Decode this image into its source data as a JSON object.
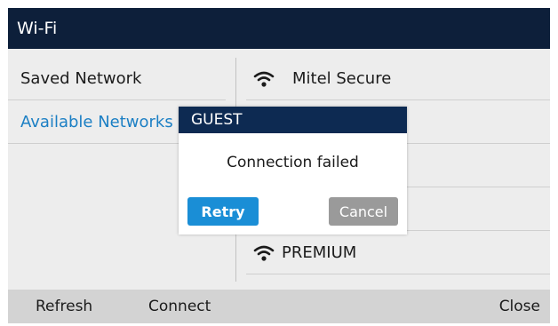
{
  "window": {
    "title": "Wi-Fi"
  },
  "left_menu": {
    "items": [
      {
        "label": "Saved Network",
        "active": false
      },
      {
        "label": "Available Networks",
        "active": true
      }
    ]
  },
  "networks": [
    {
      "ssid": "Mitel Secure",
      "icon": "wifi-icon"
    },
    {
      "ssid": "",
      "icon": ""
    },
    {
      "ssid": "",
      "icon": ""
    },
    {
      "ssid": "",
      "icon": ""
    },
    {
      "ssid": "PREMIUM",
      "icon": "wifi-icon"
    }
  ],
  "dialog": {
    "title": "GUEST",
    "message": "Connection failed",
    "retry_label": "Retry",
    "cancel_label": "Cancel"
  },
  "softkeys": {
    "refresh": "Refresh",
    "connect": "Connect",
    "close": "Close"
  },
  "colors": {
    "titlebar": "#0d1f3a",
    "dialog_title": "#0d2a52",
    "accent": "#1a8ed6",
    "active_text": "#1b7fc4",
    "cancel": "#9a9a9a"
  }
}
